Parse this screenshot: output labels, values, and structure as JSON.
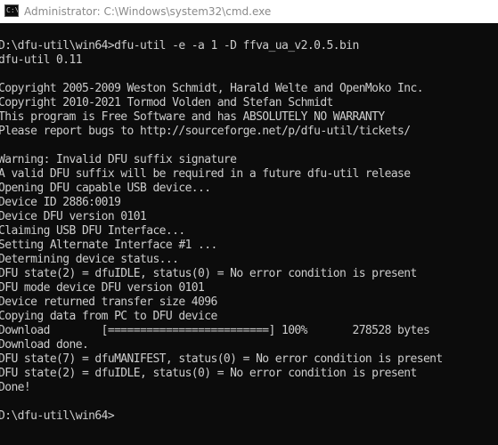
{
  "window": {
    "title": "Administrator: C:\\Windows\\system32\\cmd.exe",
    "icon": "cmd-icon",
    "background": "#0c0c0c",
    "text_color": "#cccccc"
  },
  "console": {
    "lines": [
      "D:\\dfu-util\\win64>dfu-util -e -a 1 -D ffva_ua_v2.0.5.bin",
      "dfu-util 0.11",
      "",
      "Copyright 2005-2009 Weston Schmidt, Harald Welte and OpenMoko Inc.",
      "Copyright 2010-2021 Tormod Volden and Stefan Schmidt",
      "This program is Free Software and has ABSOLUTELY NO WARRANTY",
      "Please report bugs to http://sourceforge.net/p/dfu-util/tickets/",
      "",
      "Warning: Invalid DFU suffix signature",
      "A valid DFU suffix will be required in a future dfu-util release",
      "Opening DFU capable USB device...",
      "Device ID 2886:0019",
      "Device DFU version 0101",
      "Claiming USB DFU Interface...",
      "Setting Alternate Interface #1 ...",
      "Determining device status...",
      "DFU state(2) = dfuIDLE, status(0) = No error condition is present",
      "DFU mode device DFU version 0101",
      "Device returned transfer size 4096",
      "Copying data from PC to DFU device",
      "Download        [=========================] 100%       278528 bytes",
      "Download done.",
      "DFU state(7) = dfuMANIFEST, status(0) = No error condition is present",
      "DFU state(2) = dfuIDLE, status(0) = No error condition is present",
      "Done!",
      "",
      "D:\\dfu-util\\win64>"
    ]
  }
}
